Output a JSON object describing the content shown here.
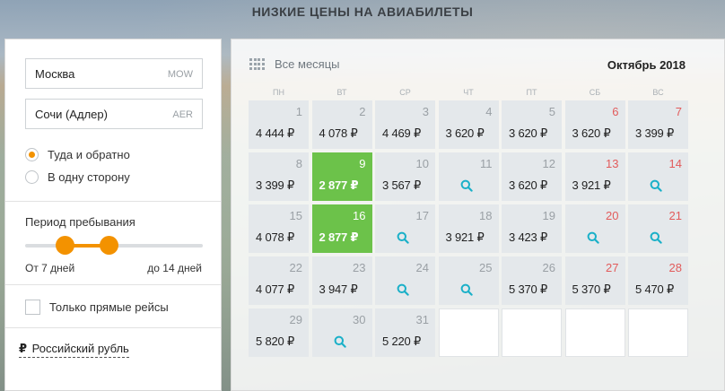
{
  "page_title": "НИЗКИЕ ЦЕНЫ НА АВИАБИЛЕТЫ",
  "search": {
    "origin": {
      "city": "Москва",
      "code": "MOW"
    },
    "destination": {
      "city": "Сочи (Адлер)",
      "code": "AER"
    }
  },
  "trip_type": {
    "round_trip_label": "Туда и обратно",
    "one_way_label": "В одну сторону",
    "selected": "round_trip"
  },
  "stay_period": {
    "title": "Период пребывания",
    "from_label": "От 7 дней",
    "to_label": "до 14 дней",
    "min_days": 7,
    "max_days": 14,
    "range_start_fraction": 0.22,
    "range_end_fraction": 0.47
  },
  "direct_only": {
    "label": "Только прямые рейсы",
    "checked": false
  },
  "currency": {
    "symbol": "₽",
    "label": "Российский рубль"
  },
  "calendar": {
    "all_months_label": "Все месяцы",
    "month_title": "Октябрь 2018",
    "weekdays": [
      "ПН",
      "ВТ",
      "СР",
      "ЧТ",
      "ПТ",
      "СБ",
      "ВС"
    ],
    "days": [
      {
        "day": "1",
        "price": "4 444 ₽",
        "weekend": false,
        "best": false
      },
      {
        "day": "2",
        "price": "4 078 ₽",
        "weekend": false,
        "best": false
      },
      {
        "day": "3",
        "price": "4 469 ₽",
        "weekend": false,
        "best": false
      },
      {
        "day": "4",
        "price": "3 620 ₽",
        "weekend": false,
        "best": false
      },
      {
        "day": "5",
        "price": "3 620 ₽",
        "weekend": false,
        "best": false
      },
      {
        "day": "6",
        "price": "3 620 ₽",
        "weekend": true,
        "best": false
      },
      {
        "day": "7",
        "price": "3 399 ₽",
        "weekend": true,
        "best": false
      },
      {
        "day": "8",
        "price": "3 399 ₽",
        "weekend": false,
        "best": false
      },
      {
        "day": "9",
        "price": "2 877 ₽",
        "weekend": false,
        "best": true
      },
      {
        "day": "10",
        "price": "3 567 ₽",
        "weekend": false,
        "best": false
      },
      {
        "day": "11",
        "price": null,
        "weekend": false,
        "best": false
      },
      {
        "day": "12",
        "price": "3 620 ₽",
        "weekend": false,
        "best": false
      },
      {
        "day": "13",
        "price": "3 921 ₽",
        "weekend": true,
        "best": false
      },
      {
        "day": "14",
        "price": null,
        "weekend": true,
        "best": false
      },
      {
        "day": "15",
        "price": "4 078 ₽",
        "weekend": false,
        "best": false
      },
      {
        "day": "16",
        "price": "2 877 ₽",
        "weekend": false,
        "best": true
      },
      {
        "day": "17",
        "price": null,
        "weekend": false,
        "best": false
      },
      {
        "day": "18",
        "price": "3 921 ₽",
        "weekend": false,
        "best": false
      },
      {
        "day": "19",
        "price": "3 423 ₽",
        "weekend": false,
        "best": false
      },
      {
        "day": "20",
        "price": null,
        "weekend": true,
        "best": false
      },
      {
        "day": "21",
        "price": null,
        "weekend": true,
        "best": false
      },
      {
        "day": "22",
        "price": "4 077 ₽",
        "weekend": false,
        "best": false
      },
      {
        "day": "23",
        "price": "3 947 ₽",
        "weekend": false,
        "best": false
      },
      {
        "day": "24",
        "price": null,
        "weekend": false,
        "best": false
      },
      {
        "day": "25",
        "price": null,
        "weekend": false,
        "best": false
      },
      {
        "day": "26",
        "price": "5 370 ₽",
        "weekend": false,
        "best": false
      },
      {
        "day": "27",
        "price": "5 370 ₽",
        "weekend": true,
        "best": false
      },
      {
        "day": "28",
        "price": "5 470 ₽",
        "weekend": true,
        "best": false
      },
      {
        "day": "29",
        "price": "5 820 ₽",
        "weekend": false,
        "best": false
      },
      {
        "day": "30",
        "price": null,
        "weekend": false,
        "best": false
      },
      {
        "day": "31",
        "price": "5 220 ₽",
        "weekend": false,
        "best": false
      }
    ],
    "empty_cells": 4
  },
  "colors": {
    "accent": "#f39200",
    "best_price": "#6cc24a",
    "weekend": "#e25b5b",
    "search_icon": "#1ab0c8"
  }
}
